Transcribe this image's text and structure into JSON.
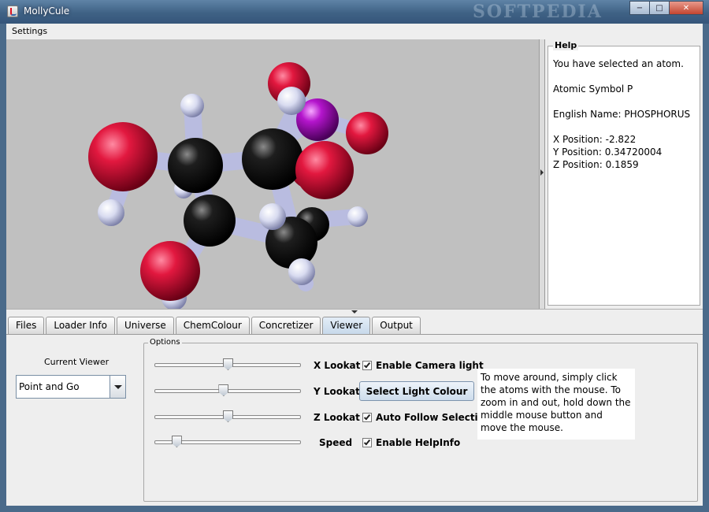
{
  "window": {
    "title": "MollyCule",
    "watermark": "SOFTPEDIA",
    "controls": {
      "minimize": "−",
      "maximize": "□",
      "close": "✕"
    }
  },
  "menu": {
    "settings": "Settings"
  },
  "help": {
    "legend": "Help",
    "lines": [
      "You have selected an atom.",
      "Atomic Symbol P",
      "English Name: PHOSPHORUS",
      "X Position: -2.822",
      "Y Position: 0.34720004",
      "Z Position: 0.1859"
    ]
  },
  "tabs": [
    "Files",
    "Loader Info",
    "Universe",
    "ChemColour",
    "Concretizer",
    "Viewer",
    "Output"
  ],
  "active_tab": "Viewer",
  "viewer": {
    "current_viewer_label": "Current Viewer",
    "current_viewer_value": "Point and Go",
    "options_legend": "Options",
    "sliders": [
      {
        "label": "X Lookat",
        "value": 0.5
      },
      {
        "label": "Y Lookat",
        "value": 0.47
      },
      {
        "label": "Z Lookat",
        "value": 0.5
      },
      {
        "label": "Speed",
        "value": 0.15
      }
    ],
    "checkboxes": {
      "camera_light": {
        "label": "Enable Camera light",
        "checked": true
      },
      "auto_follow": {
        "label": "Auto Follow Selection",
        "checked": true
      },
      "help_info": {
        "label": "Enable HelpInfo",
        "checked": true
      }
    },
    "light_button": "Select Light Colour",
    "hint": "To move around, simply click the atoms with the mouse. To zoom in and out, hold down the middle mouse button and move the mouse."
  },
  "colors": {
    "oxygen": "#d0103a",
    "carbon": "#151515",
    "hydrogen": "#e2e4f4",
    "phosphorus": "#b015c8",
    "bond": "#c9cce8",
    "viewport_bg": "#c0c0c0"
  }
}
